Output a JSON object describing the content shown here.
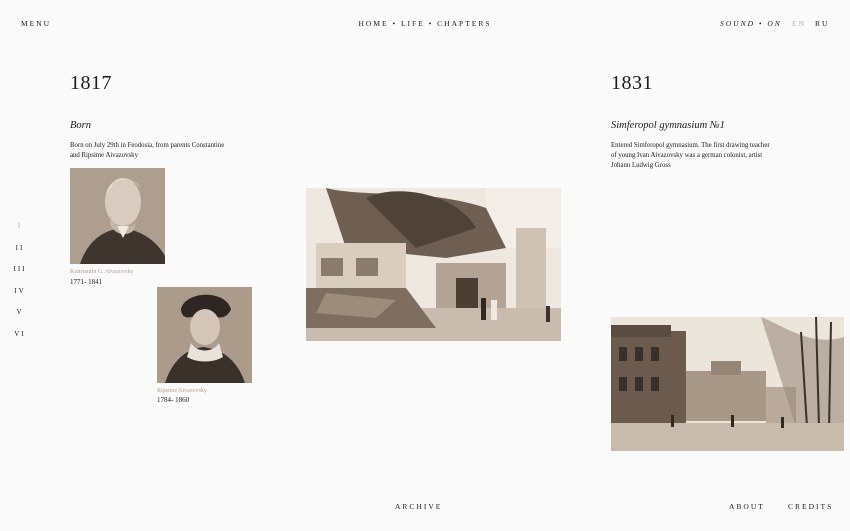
{
  "header": {
    "menu_label": "MENU",
    "nav_label": "HOME • LIFE • CHAPTERS",
    "sound_label": "SOUND • ON",
    "lang_en": "EN",
    "lang_ru": "RU"
  },
  "chapters": [
    "I",
    "II",
    "III",
    "IV",
    "V",
    "VI"
  ],
  "entries": [
    {
      "year": "1817",
      "title": "Born",
      "text_lines": [
        "Born on July 29th in Feodosia, from parents Constantine",
        "and Ripsime Aivazovsky"
      ]
    },
    {
      "year": "1831",
      "title": "Simferopol gymnasium №1",
      "text_lines": [
        "Entered Simferopol gymnasium. The first drawing teacher",
        "of young Ivan Aivazovsky was a german colonist, artist",
        "Johann Ludwig Gross"
      ]
    }
  ],
  "portraits": [
    {
      "name": "Konstantin G. Aivazovsky",
      "years": "1771- 1841"
    },
    {
      "name": "Ripsime Aivazovsky",
      "years": "1784- 1860"
    }
  ],
  "footer": {
    "archive_label": "ARCHIVE",
    "about_label": "ABOUT",
    "credits_label": "CREDITS"
  }
}
